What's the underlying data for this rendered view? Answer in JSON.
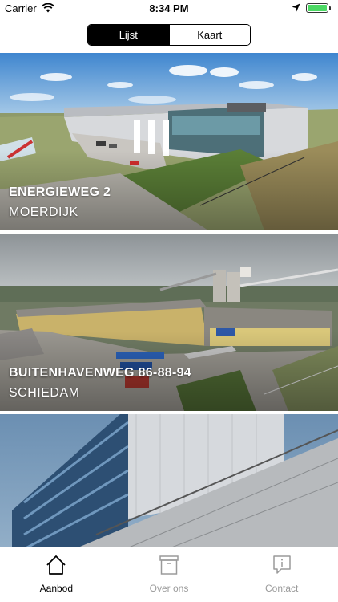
{
  "status_bar": {
    "carrier": "Carrier",
    "time": "8:34 PM",
    "battery_color": "#4cd964"
  },
  "view_switcher": {
    "options": [
      "Lijst",
      "Kaart"
    ],
    "selected": "Lijst"
  },
  "listings": [
    {
      "title": "ENERGIEWEG 2",
      "city": "MOERDIJK"
    },
    {
      "title": "BUITENHAVENWEG 86-88-94",
      "city": "SCHIEDAM"
    },
    {
      "title": "",
      "city": ""
    }
  ],
  "tab_bar": {
    "items": [
      {
        "label": "Aanbod",
        "icon": "home-icon",
        "active": true
      },
      {
        "label": "Over ons",
        "icon": "archive-box-icon",
        "active": false
      },
      {
        "label": "Contact",
        "icon": "info-chat-icon",
        "active": false
      }
    ]
  },
  "colors": {
    "active_text": "#000000",
    "inactive_text": "#9a9a9a",
    "segment_active_bg": "#000000"
  }
}
